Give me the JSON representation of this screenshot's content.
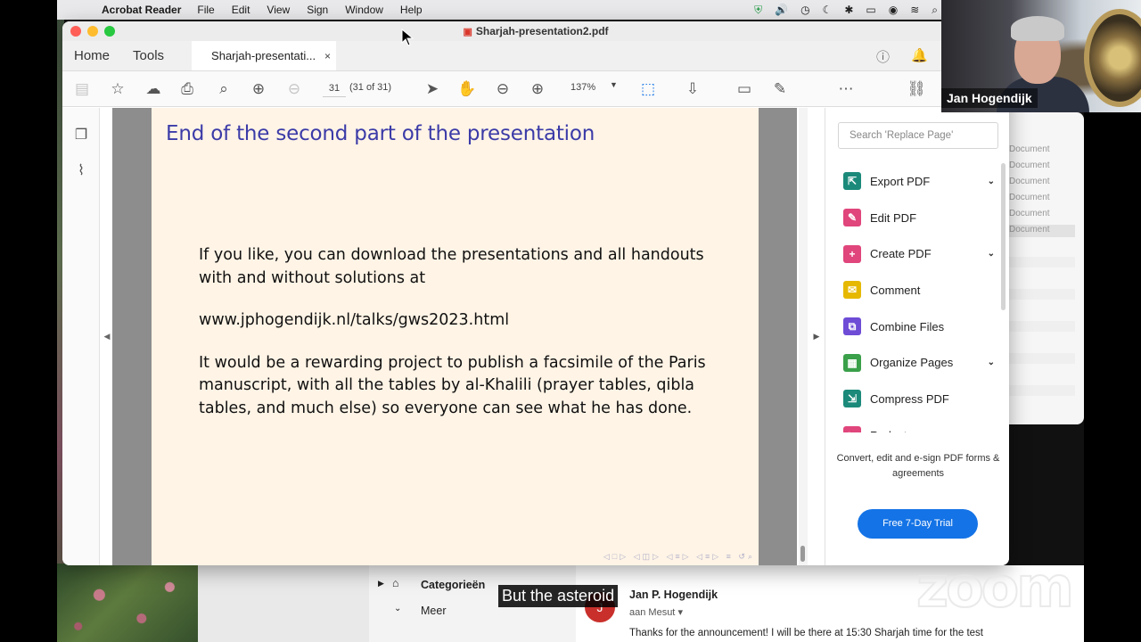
{
  "menubar": {
    "app_name": "Acrobat Reader",
    "menus": [
      "File",
      "Edit",
      "View",
      "Sign",
      "Window",
      "Help"
    ]
  },
  "window": {
    "title": "Sharjah-presentation2.pdf",
    "nav_tabs": [
      "Home",
      "Tools"
    ],
    "doc_tab": "Sharjah-presentati...",
    "doc_tab_close": "×"
  },
  "toolbar": {
    "page_number": "31",
    "page_count": "(31 of 31)",
    "zoom": "137%"
  },
  "slide": {
    "title": "End of the second part of the presentation",
    "paragraphs": [
      "If you like, you can download the presentations and all handouts with and without solutions at",
      "www.jphogendijk.nl/talks/gws2023.html",
      "It would be a rewarding project to publish a facsimile of the Paris manuscript, with all the tables by al-Khalili (prayer tables, qibla tables, and much else) so everyone can see what he has done."
    ]
  },
  "right_panel": {
    "search_placeholder": "Search 'Replace Page'",
    "tools": [
      {
        "label": "Export PDF",
        "icon": "export-pdf-icon",
        "color": "#1b8a7a",
        "has_chevron": true
      },
      {
        "label": "Edit PDF",
        "icon": "edit-pdf-icon",
        "color": "#e0457b",
        "has_chevron": false
      },
      {
        "label": "Create PDF",
        "icon": "create-pdf-icon",
        "color": "#e0457b",
        "has_chevron": true
      },
      {
        "label": "Comment",
        "icon": "comment-icon",
        "color": "#e6b800",
        "has_chevron": false
      },
      {
        "label": "Combine Files",
        "icon": "combine-files-icon",
        "color": "#6e4cd6",
        "has_chevron": false
      },
      {
        "label": "Organize Pages",
        "icon": "organize-pages-icon",
        "color": "#3aa04a",
        "has_chevron": true
      },
      {
        "label": "Compress PDF",
        "icon": "compress-pdf-icon",
        "color": "#1b8a7a",
        "has_chevron": false
      },
      {
        "label": "Redact",
        "icon": "redact-icon",
        "color": "#e0457b",
        "has_chevron": false
      }
    ],
    "promo_text": "Convert, edit and e-sign PDF forms & agreements",
    "trial_button": "Free 7-Day Trial"
  },
  "background_list": {
    "rows": [
      "Document",
      "Document",
      "Document",
      "Document",
      "Document",
      "Document"
    ]
  },
  "mail": {
    "folders": [
      "Categorieën",
      "Meer"
    ],
    "avatar_letter": "J",
    "sender": "Jan P. Hogendijk",
    "to": "aan Mesut",
    "message": "Thanks for the announcement! I will be there at 15:30 Sharjah time for the test"
  },
  "video": {
    "participant_name": "Jan Hogendijk",
    "brand": "zoom",
    "caption": "But the asteroid"
  }
}
